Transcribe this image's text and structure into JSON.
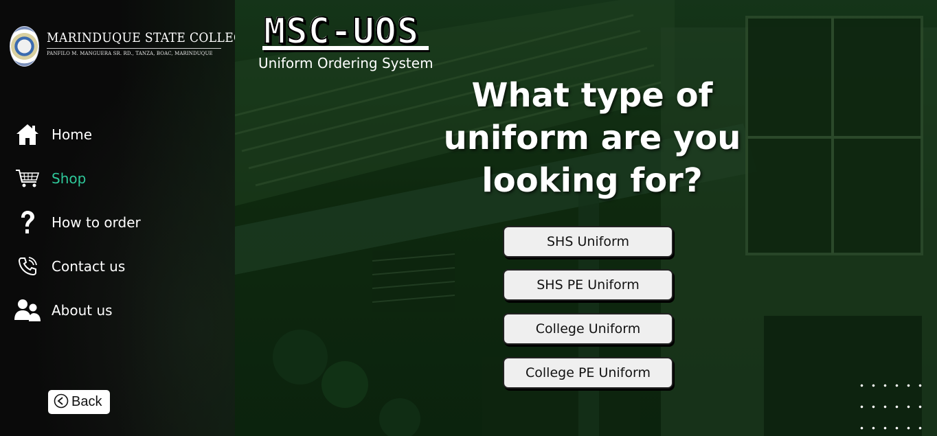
{
  "brand": {
    "name": "MARINDUQUE STATE COLLEGE",
    "address": "PANFILO M. MANGUERA SR. RD., TANZA, BOAC, MARINDUQUE"
  },
  "nav": [
    {
      "label": "Home",
      "icon": "home-icon",
      "active": false
    },
    {
      "label": "Shop",
      "icon": "cart-icon",
      "active": true
    },
    {
      "label": "How to order",
      "icon": "question-icon",
      "active": false
    },
    {
      "label": "Contact us",
      "icon": "phone-icon",
      "active": false
    },
    {
      "label": "About us",
      "icon": "users-icon",
      "active": false
    }
  ],
  "back_label": "Back",
  "app": {
    "logo": "MSC-UOS",
    "subtitle": "Uniform Ordering System"
  },
  "question": "What type of uniform are you looking for?",
  "options": [
    {
      "label": "SHS Uniform"
    },
    {
      "label": "SHS PE Uniform"
    },
    {
      "label": "College Uniform"
    },
    {
      "label": "College PE Uniform"
    }
  ],
  "colors": {
    "active_nav": "#2ec89a",
    "sidebar_bg": "#0a0a0a",
    "hero_tint": "#10280f"
  }
}
